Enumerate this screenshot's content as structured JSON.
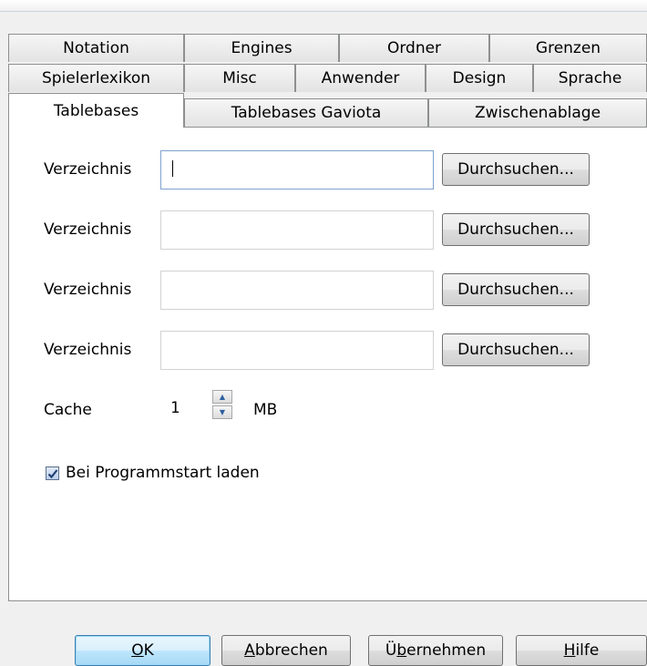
{
  "tabs_row1": [
    "Notation",
    "Engines",
    "Ordner",
    "Grenzen"
  ],
  "tabs_row2": [
    "Spielerlexikon",
    "Misc",
    "Anwender",
    "Design",
    "Sprache"
  ],
  "tabs_row3": [
    "Tablebases",
    "Tablebases Gaviota",
    "Zwischenablage"
  ],
  "active_tab": "Tablebases",
  "directories": [
    {
      "label": "Verzeichnis",
      "value": "",
      "browse_label": "Durchsuchen..."
    },
    {
      "label": "Verzeichnis",
      "value": "",
      "browse_label": "Durchsuchen..."
    },
    {
      "label": "Verzeichnis",
      "value": "",
      "browse_label": "Durchsuchen..."
    },
    {
      "label": "Verzeichnis",
      "value": "",
      "browse_label": "Durchsuchen..."
    }
  ],
  "cache": {
    "label": "Cache",
    "value": "1",
    "unit": "MB"
  },
  "load_on_start": {
    "label": "Bei Programmstart laden",
    "checked": true
  },
  "buttons": {
    "ok": {
      "pre": "",
      "acc": "O",
      "post": "K"
    },
    "cancel": {
      "pre": "",
      "acc": "A",
      "post": "bbrechen"
    },
    "apply": {
      "pre": "Ü",
      "acc": "b",
      "post": "ernehmen"
    },
    "help": {
      "pre": "",
      "acc": "H",
      "post": "ilfe"
    }
  },
  "colors": {
    "accent": "#3c7fb1",
    "panel": "#ffffff",
    "dialog": "#f0f0f0"
  }
}
